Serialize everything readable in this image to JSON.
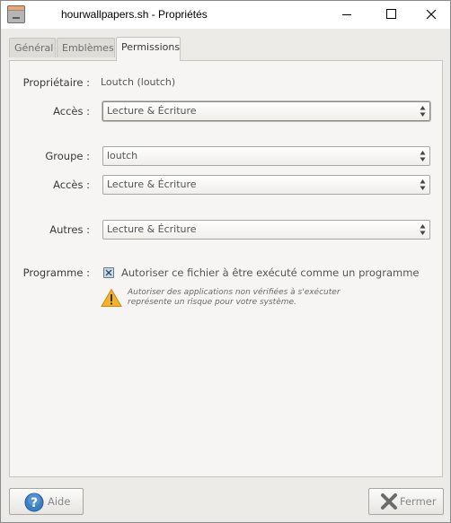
{
  "window": {
    "title": "hourwallpapers.sh - Propriétés"
  },
  "tabs": [
    {
      "label": "Général"
    },
    {
      "label": "Emblèmes"
    },
    {
      "label": "Permissions"
    }
  ],
  "permissions": {
    "owner_label": "Propriétaire :",
    "owner_value": "Loutch (loutch)",
    "owner_access_label": "Accès :",
    "owner_access_value": "Lecture & Écriture",
    "group_label": "Groupe :",
    "group_value": "loutch",
    "group_access_label": "Accès :",
    "group_access_value": "Lecture & Écriture",
    "others_label": "Autres :",
    "others_value": "Lecture & Écriture",
    "program_label": "Programme :",
    "program_checkbox_label": "Autoriser ce fichier à être exécuté comme un programme",
    "program_checked": true,
    "warning_line1": "Autoriser des applications non vérifiées à s'exécuter",
    "warning_line2": "représente un risque pour votre système."
  },
  "buttons": {
    "help_label": "Aide",
    "close_label": "Fermer"
  },
  "icons": {
    "app": "terminal-script-icon",
    "help": "help-icon",
    "close": "close-x-icon",
    "warning": "warning-icon"
  },
  "colors": {
    "help_icon": "#3b7fc4",
    "close_icon": "#6b6b6b",
    "warning": "#f0b429"
  }
}
